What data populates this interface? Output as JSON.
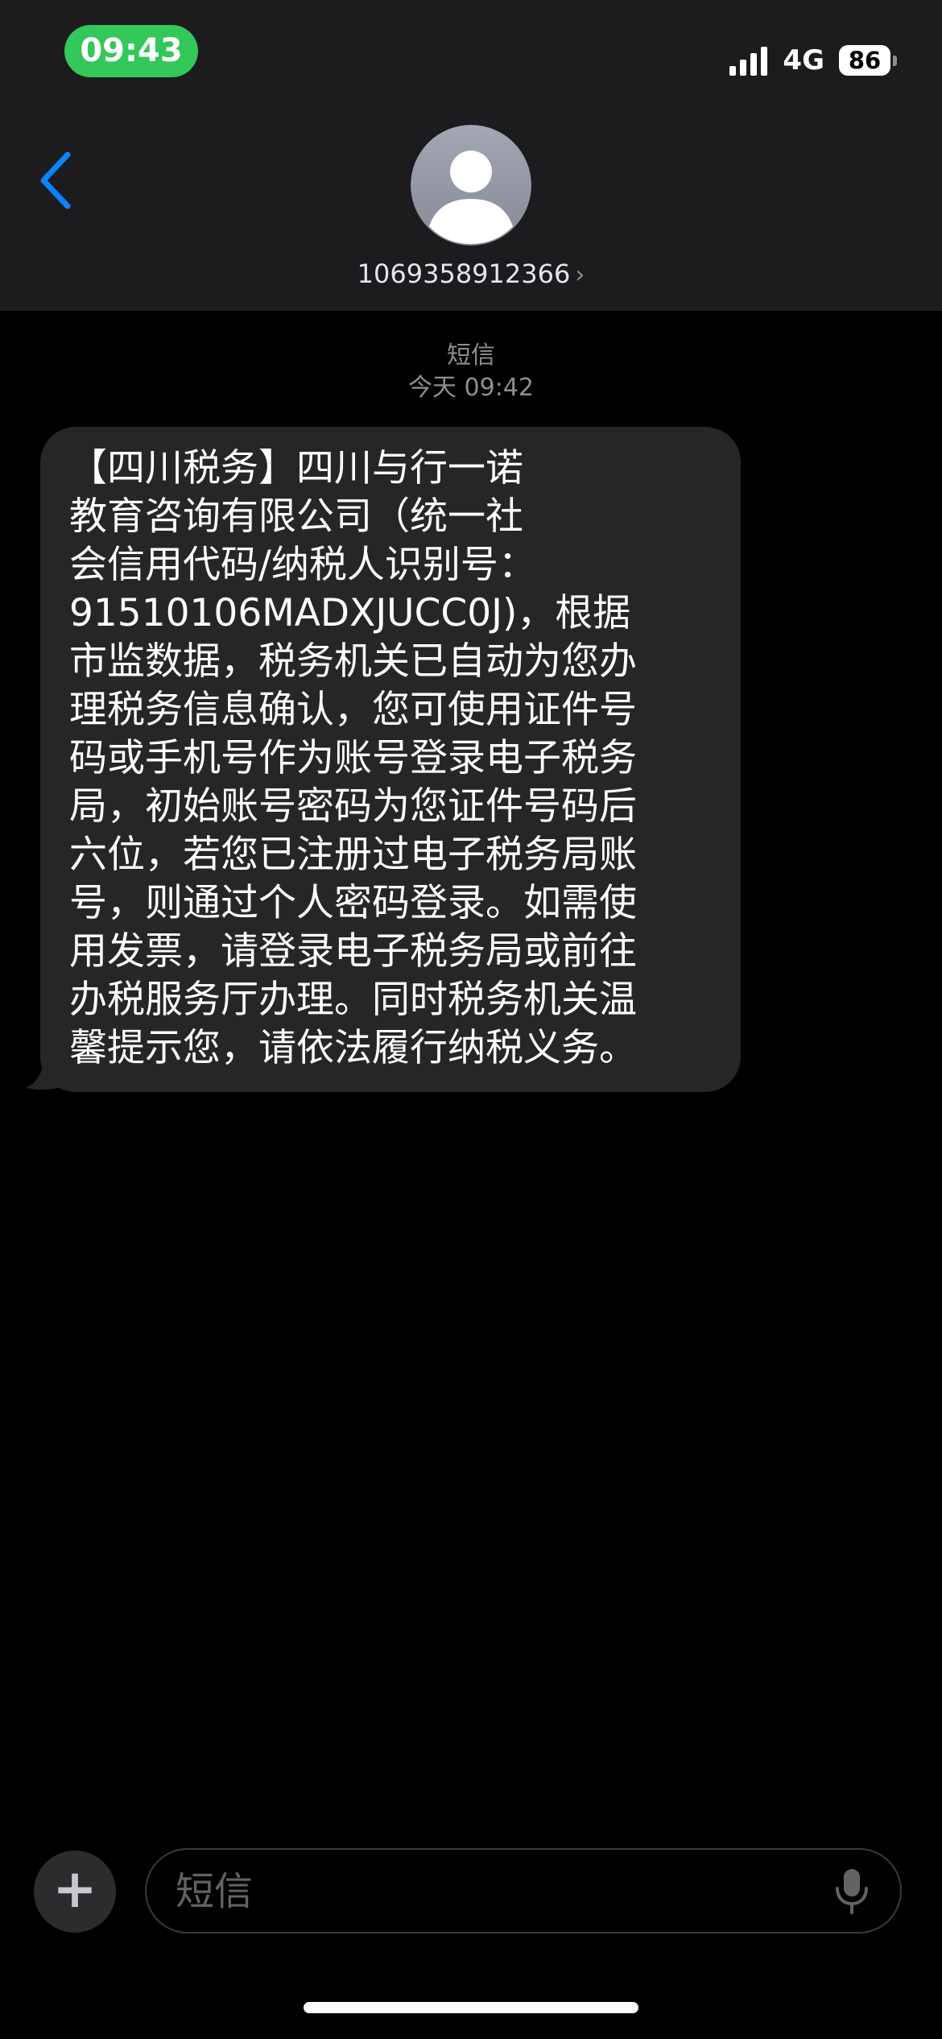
{
  "status_bar": {
    "time": "09:43",
    "network": "4G",
    "battery": "86"
  },
  "header": {
    "contact": "1069358912366",
    "chevron": "›",
    "back_icon": "chevron-left-icon",
    "avatar_icon": "person-icon"
  },
  "thread": {
    "service": "短信",
    "timestamp": "今天 09:42"
  },
  "messages": [
    {
      "direction": "incoming",
      "text": "【四川税务】四川与行一诺\n教育咨询有限公司（统一社\n会信用代码/纳税人识别号：\n91510106MADXJUCC0J)，根据\n市监数据，税务机关已自动为您办\n理税务信息确认，您可使用证件号\n码或手机号作为账号登录电子税务\n局，初始账号密码为您证件号码后\n六位，若您已注册过电子税务局账\n号，则通过个人密码登录。如需使\n用发票，请登录电子税务局或前往\n办税服务厅办理。同时税务机关温\n馨提示您，请依法履行纳税义务。"
    }
  ],
  "compose": {
    "plus": "+",
    "placeholder": "短信",
    "value": "",
    "mic_icon": "microphone-icon"
  },
  "colors": {
    "accent": "#0a84ff",
    "time_pill": "#34c759",
    "header_bg": "#1c1c1e",
    "bubble_bg": "#262628"
  }
}
